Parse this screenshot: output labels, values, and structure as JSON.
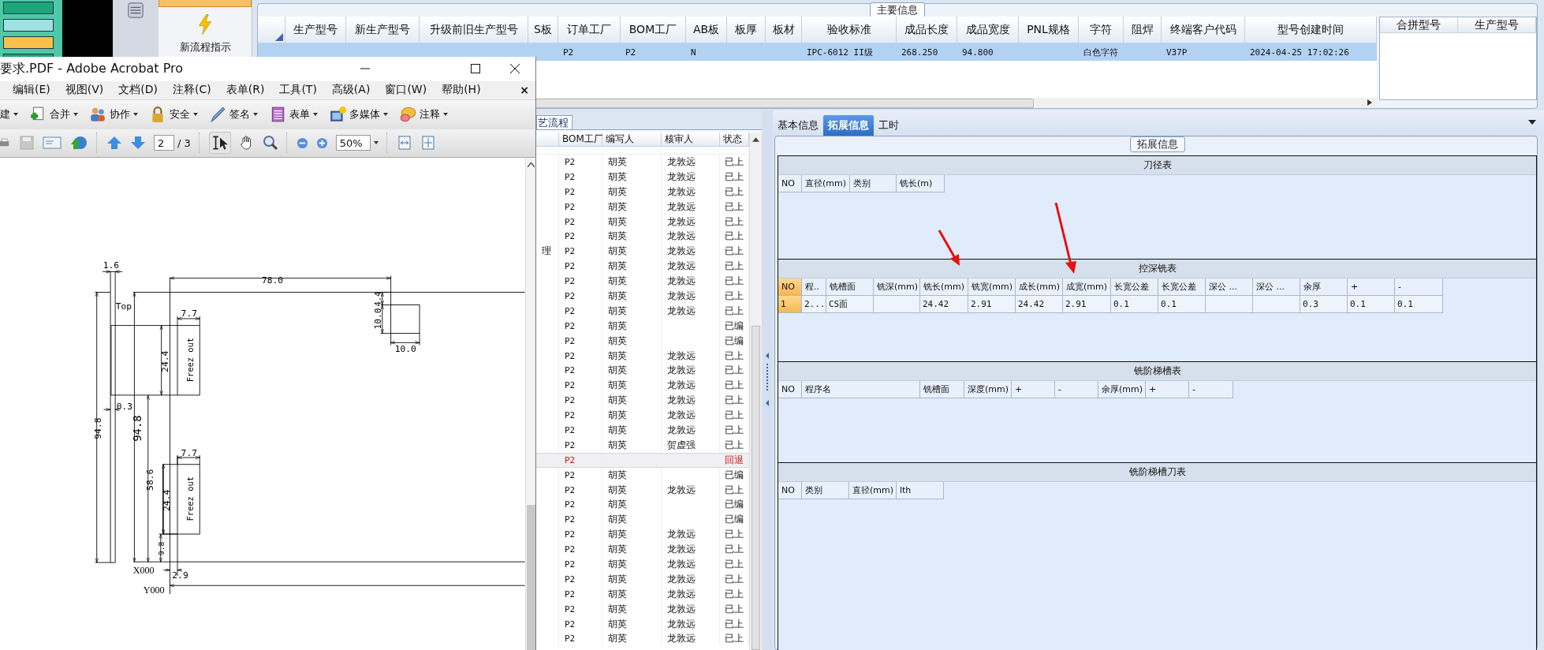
{
  "left_app": {
    "menu_item": "新流程指示"
  },
  "main_info": {
    "title": "主要信息",
    "row_selected": true,
    "columns": [
      {
        "label": "生产型号"
      },
      {
        "label": "新生产型号"
      },
      {
        "label": "升级前旧生产型号"
      },
      {
        "label": "S板"
      },
      {
        "label": "订单工厂",
        "value": "P2"
      },
      {
        "label": "BOM工厂",
        "value": "P2"
      },
      {
        "label": "AB板",
        "value": "N"
      },
      {
        "label": "板厚"
      },
      {
        "label": "板材"
      },
      {
        "label": "验收标准",
        "value": "IPC-6012 II级"
      },
      {
        "label": "成品长度",
        "value": "268.250"
      },
      {
        "label": "成品宽度",
        "value": "94.800"
      },
      {
        "label": "PNL规格"
      },
      {
        "label": "字符",
        "value": "白色字符"
      },
      {
        "label": "阻焊"
      },
      {
        "label": "终端客户代码",
        "value": "V37P"
      },
      {
        "label": "型号创建时间",
        "value": "2024-04-25 17:02:26"
      }
    ],
    "side_columns": [
      "合拼型号",
      "生产型号"
    ]
  },
  "flow_list": {
    "tab": "艺流程",
    "columns": [
      "BOM工厂",
      "编写人",
      "核审人",
      "状态"
    ],
    "rows": [
      {
        "bom": "P2",
        "writer": "胡英",
        "reviewer": "龙敦远",
        "status": "已上",
        "returned": false
      },
      {
        "bom": "P2",
        "writer": "胡英",
        "reviewer": "龙敦远",
        "status": "已上",
        "returned": false
      },
      {
        "bom": "P2",
        "writer": "胡英",
        "reviewer": "龙敦远",
        "status": "已上",
        "returned": false
      },
      {
        "bom": "P2",
        "writer": "胡英",
        "reviewer": "龙敦远",
        "status": "已上",
        "returned": false
      },
      {
        "bom": "P2",
        "writer": "胡英",
        "reviewer": "龙敦远",
        "status": "已上",
        "returned": false
      },
      {
        "bom": "P2",
        "writer": "胡英",
        "reviewer": "龙敦远",
        "status": "已上",
        "returned": false
      },
      {
        "column_1": "理",
        "bom": "P2",
        "writer": "胡英",
        "reviewer": "龙敦远",
        "status": "已上",
        "returned": false
      },
      {
        "bom": "P2",
        "writer": "胡英",
        "reviewer": "龙敦远",
        "status": "已上",
        "returned": false
      },
      {
        "bom": "P2",
        "writer": "胡英",
        "reviewer": "龙敦远",
        "status": "已上",
        "returned": false
      },
      {
        "bom": "P2",
        "writer": "胡英",
        "reviewer": "龙敦远",
        "status": "已上",
        "returned": false
      },
      {
        "bom": "P2",
        "writer": "胡英",
        "reviewer": "龙敦远",
        "status": "已上",
        "returned": false
      },
      {
        "bom": "P2",
        "writer": "胡英",
        "status": "已编",
        "returned": false
      },
      {
        "bom": "P2",
        "writer": "胡英",
        "status": "已编",
        "returned": false
      },
      {
        "bom": "P2",
        "writer": "胡英",
        "reviewer": "龙敦远",
        "status": "已上",
        "returned": false
      },
      {
        "bom": "P2",
        "writer": "胡英",
        "reviewer": "龙敦远",
        "status": "已上",
        "returned": false
      },
      {
        "bom": "P2",
        "writer": "胡英",
        "reviewer": "龙敦远",
        "status": "已上",
        "returned": false
      },
      {
        "bom": "P2",
        "writer": "胡英",
        "reviewer": "龙敦远",
        "status": "已上",
        "returned": false
      },
      {
        "bom": "P2",
        "writer": "胡英",
        "reviewer": "龙敦远",
        "status": "已上",
        "returned": false
      },
      {
        "bom": "P2",
        "writer": "胡英",
        "reviewer": "龙敦远",
        "status": "已上",
        "returned": false
      },
      {
        "bom": "P2",
        "writer": "胡英",
        "reviewer": "贺虚强",
        "status": "已上",
        "returned": false
      },
      {
        "bom": "P2",
        "status": "回退",
        "returned": true
      },
      {
        "bom": "P2",
        "writer": "胡英",
        "status": "已编",
        "returned": false
      },
      {
        "bom": "P2",
        "writer": "胡英",
        "reviewer": "龙敦远",
        "status": "已上",
        "returned": false
      },
      {
        "bom": "P2",
        "writer": "胡英",
        "status": "已编",
        "returned": false
      },
      {
        "bom": "P2",
        "writer": "胡英",
        "status": "已编",
        "returned": false
      },
      {
        "bom": "P2",
        "writer": "胡英",
        "reviewer": "龙敦远",
        "status": "已上",
        "returned": false
      },
      {
        "bom": "P2",
        "writer": "胡英",
        "reviewer": "龙敦远",
        "status": "已上",
        "returned": false
      },
      {
        "bom": "P2",
        "writer": "胡英",
        "reviewer": "龙敦远",
        "status": "已上",
        "returned": false
      },
      {
        "bom": "P2",
        "writer": "胡英",
        "reviewer": "龙敦远",
        "status": "已上",
        "returned": false
      },
      {
        "bom": "P2",
        "writer": "胡英",
        "reviewer": "龙敦远",
        "status": "已上",
        "returned": false
      },
      {
        "bom": "P2",
        "writer": "胡英",
        "reviewer": "龙敦远",
        "status": "已上",
        "returned": false
      },
      {
        "bom": "P2",
        "writer": "胡英",
        "reviewer": "龙敦远",
        "status": "已上",
        "returned": false
      },
      {
        "bom": "P2",
        "writer": "胡英",
        "reviewer": "龙敦远",
        "status": "已上",
        "returned": false
      }
    ]
  },
  "detail": {
    "tabs": [
      {
        "label": "基本信息",
        "selected": false
      },
      {
        "label": "拓展信息",
        "selected": true
      },
      {
        "label": "工时",
        "selected": false
      }
    ],
    "group_title": "拓展信息",
    "sections": [
      {
        "title": "刀径表",
        "columns": [
          {
            "label": "NO"
          },
          {
            "label": "直径(mm)"
          },
          {
            "label": "类别"
          },
          {
            "label": "铣长(m)"
          }
        ]
      },
      {
        "title": "控深铣表",
        "row_selected": true,
        "columns": [
          {
            "label": "NO",
            "value": "1"
          },
          {
            "label": "程..",
            "value": "2..."
          },
          {
            "label": "铣槽面",
            "value": "CS面"
          },
          {
            "label": "铣深(mm)"
          },
          {
            "label": "铣长(mm)",
            "value": "24.42"
          },
          {
            "label": "铣宽(mm)",
            "value": "2.91"
          },
          {
            "label": "成长(mm)",
            "value": "24.42"
          },
          {
            "label": "成宽(mm)",
            "value": "2.91"
          },
          {
            "label": "长宽公差",
            "value": "0.1"
          },
          {
            "label": "长宽公差",
            "value": "0.1"
          },
          {
            "label": "深公 ..."
          },
          {
            "label": "深公 ..."
          },
          {
            "label": "余厚",
            "value": "0.3"
          },
          {
            "label": "+",
            "value": "0.1"
          },
          {
            "label": "-",
            "value": "0.1"
          }
        ]
      },
      {
        "title": "铣阶梯槽表",
        "columns": [
          {
            "label": "NO"
          },
          {
            "label": "程序名"
          },
          {
            "label": "铣槽面"
          },
          {
            "label": "深度(mm)"
          },
          {
            "label": "+"
          },
          {
            "label": "-"
          },
          {
            "label": "余厚(mm)"
          },
          {
            "label": "+"
          },
          {
            "label": "-"
          }
        ]
      },
      {
        "title": "铣阶梯槽刀表",
        "columns": [
          {
            "label": "NO"
          },
          {
            "label": "类别"
          },
          {
            "label": "直径(mm)"
          },
          {
            "label": "lth"
          }
        ]
      }
    ]
  },
  "acrobat": {
    "title": "要求.PDF - Adobe Acrobat Pro",
    "menu": [
      "编辑(E)",
      "视图(V)",
      "文档(D)",
      "注释(C)",
      "表单(R)",
      "工具(T)",
      "高级(A)",
      "窗口(W)",
      "帮助(H)"
    ],
    "menu_close": "×",
    "toolbar": [
      "建",
      "合并",
      "协作",
      "安全",
      "签名",
      "表单",
      "多媒体",
      "注释"
    ],
    "page": "2",
    "page_count": "/ 3",
    "zoom": "50%",
    "drawing_labels": [
      "1.6",
      "78.0",
      "Top",
      "7.7",
      "24.4",
      "Freez out",
      "4.4",
      "10.0",
      "10.0",
      "0.3",
      "94.8",
      "94.8",
      "58.6",
      "7.7",
      "24.4",
      "Freez out",
      "9.8",
      "X000",
      "2.9",
      "Y000"
    ]
  }
}
